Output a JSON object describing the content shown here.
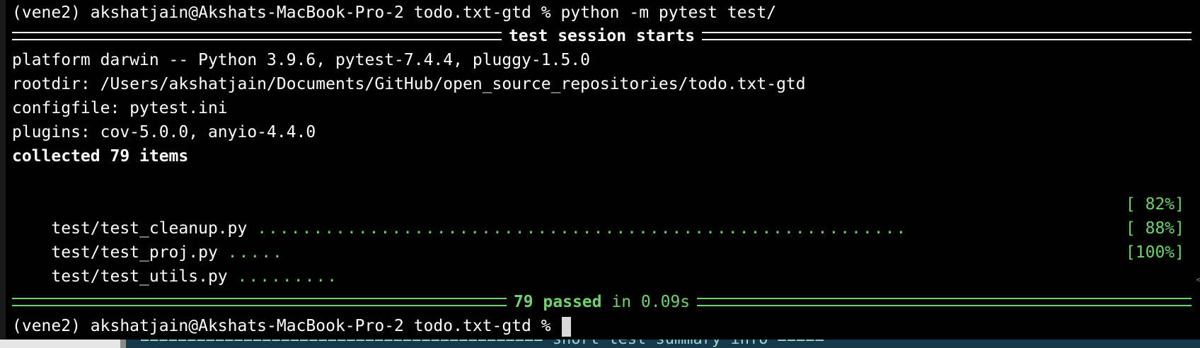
{
  "terminal": {
    "prompt_line_1": "(vene2) akshatjain@Akshats-MacBook-Pro-2 todo.txt-gtd % python -m pytest test/",
    "session_header": "test session starts",
    "platform_line": "platform darwin -- Python 3.9.6, pytest-7.4.4, pluggy-1.5.0",
    "rootdir_line": "rootdir: /Users/akshatjain/Documents/GitHub/open_source_repositories/todo.txt-gtd",
    "configfile_line": "configfile: pytest.ini",
    "plugins_line": "plugins: cov-5.0.0, anyio-4.4.0",
    "collected_line": "collected 79 items",
    "tests": [
      {
        "file": "test/test_cleanup.py",
        "dots": "..........................................................",
        "percent": "[ 82%]"
      },
      {
        "file": "test/test_proj.py",
        "dots": ".....",
        "percent": "[ 88%]"
      },
      {
        "file": "test/test_utils.py",
        "dots": ".........",
        "percent": "[100%]"
      }
    ],
    "summary_passed": "79 passed",
    "summary_in": "in 0.09s",
    "prompt_line_2": "(vene2) akshatjain@Akshats-MacBook-Pro-2 todo.txt-gtd % "
  },
  "background_window": {
    "partial_text": "short test summary info"
  },
  "colors": {
    "terminal_bg": "#000000",
    "text": "#ffffff",
    "pass_green": "#6bd46b"
  }
}
